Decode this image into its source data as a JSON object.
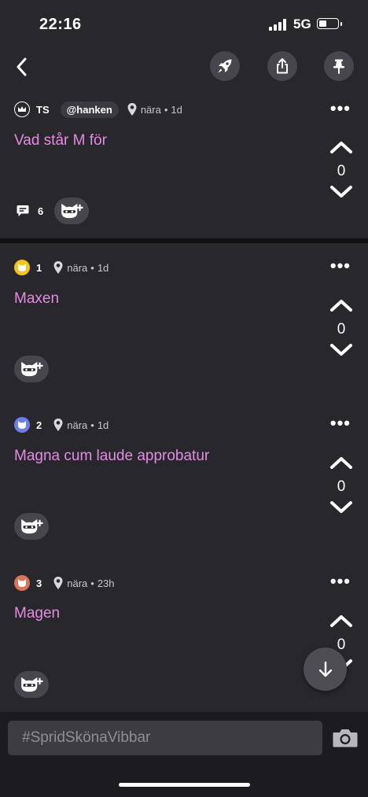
{
  "status_bar": {
    "time": "22:16",
    "network": "5G"
  },
  "thread": {
    "rank": "TS",
    "handle": "@hanken",
    "location": "nära",
    "age": "1d",
    "text": "Vad står M för",
    "votes": "0",
    "comment_count": "6"
  },
  "replies": [
    {
      "rank": "1",
      "location": "nära",
      "age": "1d",
      "text": "Maxen",
      "votes": "0",
      "avatar_color": "#f5c518"
    },
    {
      "rank": "2",
      "location": "nära",
      "age": "1d",
      "text": "Magna cum laude approbatur",
      "votes": "0",
      "avatar_color": "#6b7fe8"
    },
    {
      "rank": "3",
      "location": "nära",
      "age": "23h",
      "text": "Magen",
      "votes": "0",
      "avatar_color": "#d9745a"
    }
  ],
  "composer": {
    "placeholder": "#SpridSkönaVibbar"
  },
  "colors": {
    "accent_text": "#e58be6",
    "background": "#27272c",
    "button": "#46464c"
  }
}
